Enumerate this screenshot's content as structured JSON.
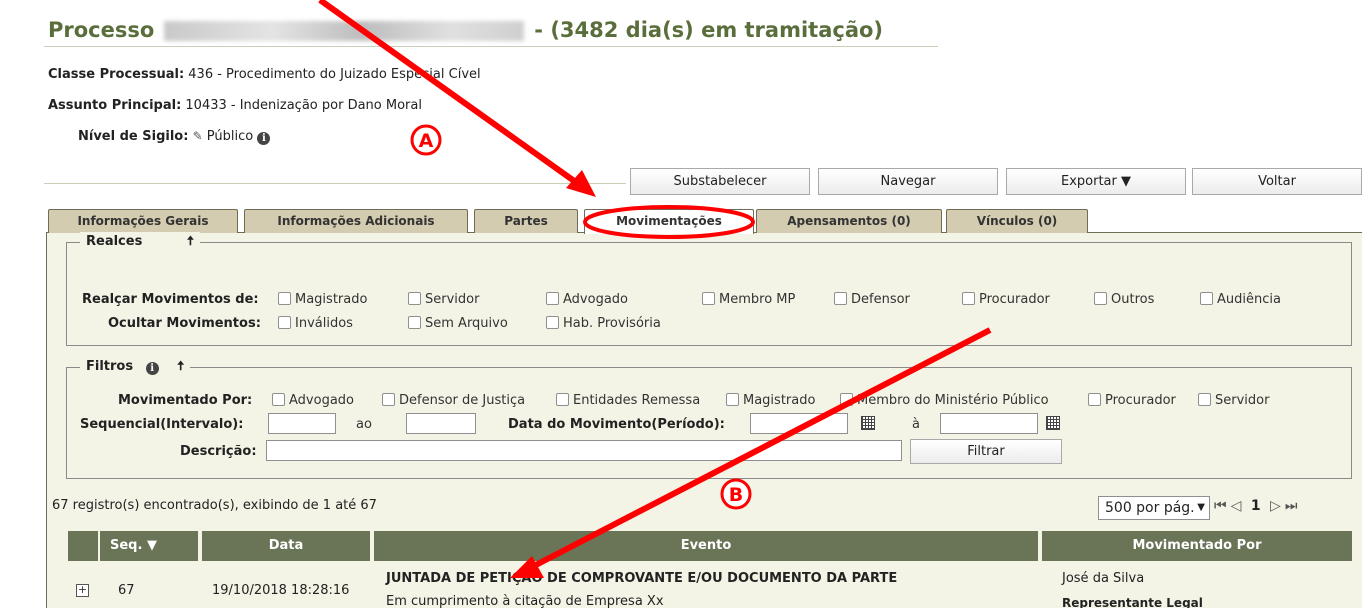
{
  "header": {
    "prefix": "Processo",
    "suffix": "-  (3482 dia(s) em tramitação)"
  },
  "info": {
    "classe_label": "Classe Processual:",
    "classe_value": "436 - Procedimento do Juizado Especial Cível",
    "assunto_label": "Assunto Principal:",
    "assunto_value": "10433 - Indenização por Dano Moral",
    "sigilo_label": "Nível de Sigilo:",
    "sigilo_value": "Público",
    "sigilo_icon": "pencil-icon"
  },
  "buttons": {
    "substabelecer": "Substabelecer",
    "navegar": "Navegar",
    "exportar": "Exportar ▼",
    "voltar": "Voltar"
  },
  "tabs": [
    {
      "label": "Informações Gerais"
    },
    {
      "label": "Informações Adicionais"
    },
    {
      "label": "Partes"
    },
    {
      "label": "Movimentações"
    },
    {
      "label": "Apensamentos (0)"
    },
    {
      "label": "Vínculos (0)"
    }
  ],
  "realces": {
    "legend": "Realces",
    "realcar_label": "Realçar Movimentos de:",
    "realcar_options": [
      "Magistrado",
      "Servidor",
      "Advogado",
      "Membro MP",
      "Defensor",
      "Procurador",
      "Outros",
      "Audiência"
    ],
    "ocultar_label": "Ocultar Movimentos:",
    "ocultar_options": [
      "Inválidos",
      "Sem Arquivo",
      "Hab. Provisória"
    ]
  },
  "filtros": {
    "legend": "Filtros",
    "mov_por_label": "Movimentado Por:",
    "mov_por_options": [
      "Advogado",
      "Defensor de Justiça",
      "Entidades Remessa",
      "Magistrado",
      "Membro do Ministério Público",
      "Procurador",
      "Servidor"
    ],
    "seq_label": "Sequencial(Intervalo):",
    "ao": "ao",
    "data_label": "Data do Movimento(Período):",
    "a": "à",
    "descricao_label": "Descrição:",
    "filtrar": "Filtrar"
  },
  "results": {
    "summary": "67 registro(s) encontrado(s), exibindo de 1 até 67",
    "per_page": "500 por pág.",
    "page": "1"
  },
  "table": {
    "headers": {
      "seq": "Seq. ▼",
      "data": "Data",
      "evento": "Evento",
      "mov_por": "Movimentado Por"
    },
    "rows": [
      {
        "seq": "67",
        "data": "19/10/2018 18:28:16",
        "evento_title": "JUNTADA DE PETIÇÃO DE COMPROVANTE E/OU DOCUMENTO DA PARTE",
        "evento_desc": "Em cumprimento à citação de Empresa Xx",
        "mov_por_name": "José da Silva",
        "mov_por_role": "Representante Legal"
      }
    ]
  },
  "annotations": {
    "a": "A",
    "b": "B",
    "color": "#ff0000"
  },
  "colors": {
    "title": "#5a6e3c",
    "table_header": "#6a7557",
    "tab": "#d3ccb0",
    "panel": "#f3f3e6"
  }
}
